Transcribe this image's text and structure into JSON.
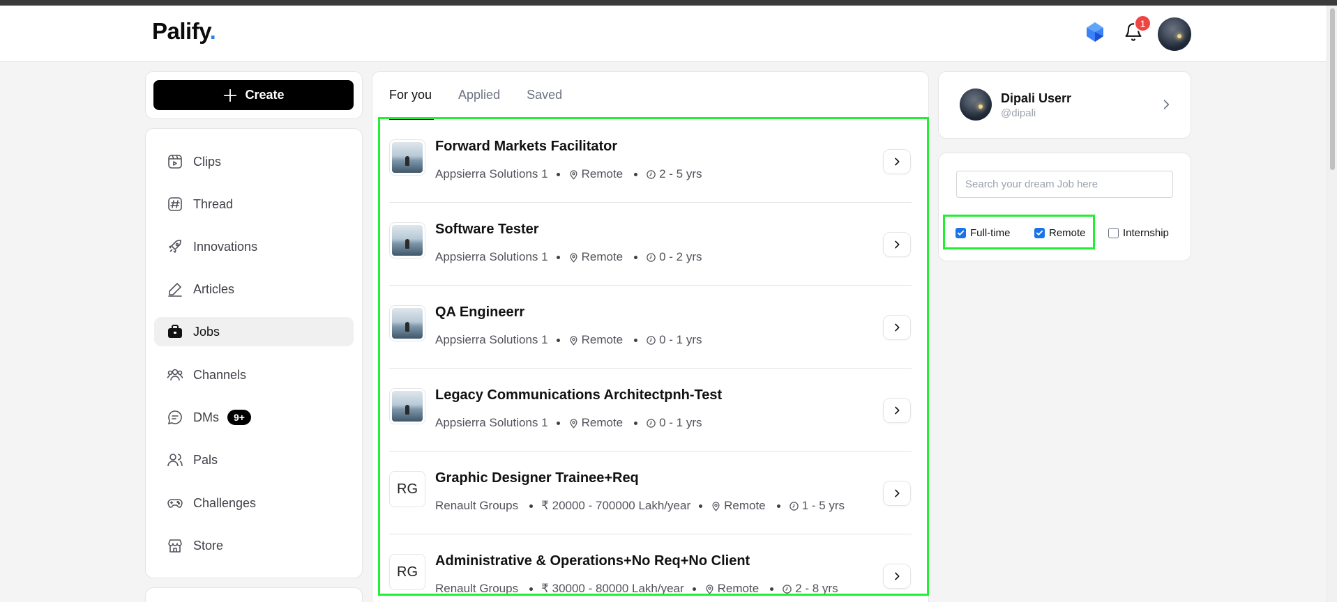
{
  "header": {
    "logo": "Palify",
    "logo_dot": ".",
    "notification_count": "1"
  },
  "sidebar": {
    "create_label": "Create",
    "items": [
      {
        "label": "Clips",
        "icon": "clips-icon"
      },
      {
        "label": "Thread",
        "icon": "hashtag-icon"
      },
      {
        "label": "Innovations",
        "icon": "rocket-icon"
      },
      {
        "label": "Articles",
        "icon": "pen-icon"
      },
      {
        "label": "Jobs",
        "icon": "briefcase-icon",
        "active": true
      },
      {
        "label": "Channels",
        "icon": "users-group-icon"
      },
      {
        "label": "DMs",
        "icon": "chat-icon",
        "badge": "9+"
      },
      {
        "label": "Pals",
        "icon": "users-icon"
      },
      {
        "label": "Challenges",
        "icon": "gamepad-icon"
      },
      {
        "label": "Store",
        "icon": "store-icon"
      }
    ]
  },
  "tabs": [
    {
      "label": "For you",
      "active": true
    },
    {
      "label": "Applied"
    },
    {
      "label": "Saved"
    }
  ],
  "jobs": [
    {
      "title": "Forward Markets Facilitator",
      "company": "Appsierra Solutions 1",
      "location": "Remote",
      "experience": "2 - 5 yrs",
      "logo": "image"
    },
    {
      "title": "Software Tester",
      "company": "Appsierra Solutions 1",
      "location": "Remote",
      "experience": "0 - 2 yrs",
      "logo": "image"
    },
    {
      "title": "QA Engineerr",
      "company": "Appsierra Solutions 1",
      "location": "Remote",
      "experience": "0 - 1 yrs",
      "logo": "image"
    },
    {
      "title": "Legacy Communications Architectpnh-Test",
      "company": "Appsierra Solutions 1",
      "location": "Remote",
      "experience": "0 - 1 yrs",
      "logo": "image"
    },
    {
      "title": "Graphic Designer Trainee+Req",
      "company": "Renault Groups",
      "salary": "₹ 20000 - 700000 Lakh/year",
      "location": "Remote",
      "experience": "1 - 5 yrs",
      "logo_text": "RG"
    },
    {
      "title": "Administrative & Operations+No Req+No Client",
      "company": "Renault Groups",
      "salary": "₹ 30000 - 80000 Lakh/year",
      "location": "Remote",
      "experience": "2 - 8 yrs",
      "logo_text": "RG"
    }
  ],
  "profile": {
    "name": "Dipali Userr",
    "handle": "@dipali"
  },
  "search": {
    "placeholder": "Search your dream Job here",
    "value": ""
  },
  "filters": [
    {
      "label": "Full-time",
      "checked": true
    },
    {
      "label": "Remote",
      "checked": true
    },
    {
      "label": "Internship",
      "checked": false
    }
  ],
  "colors": {
    "accent": "#1a73e8",
    "highlight": "#22ee33",
    "badge": "#ef4444"
  }
}
